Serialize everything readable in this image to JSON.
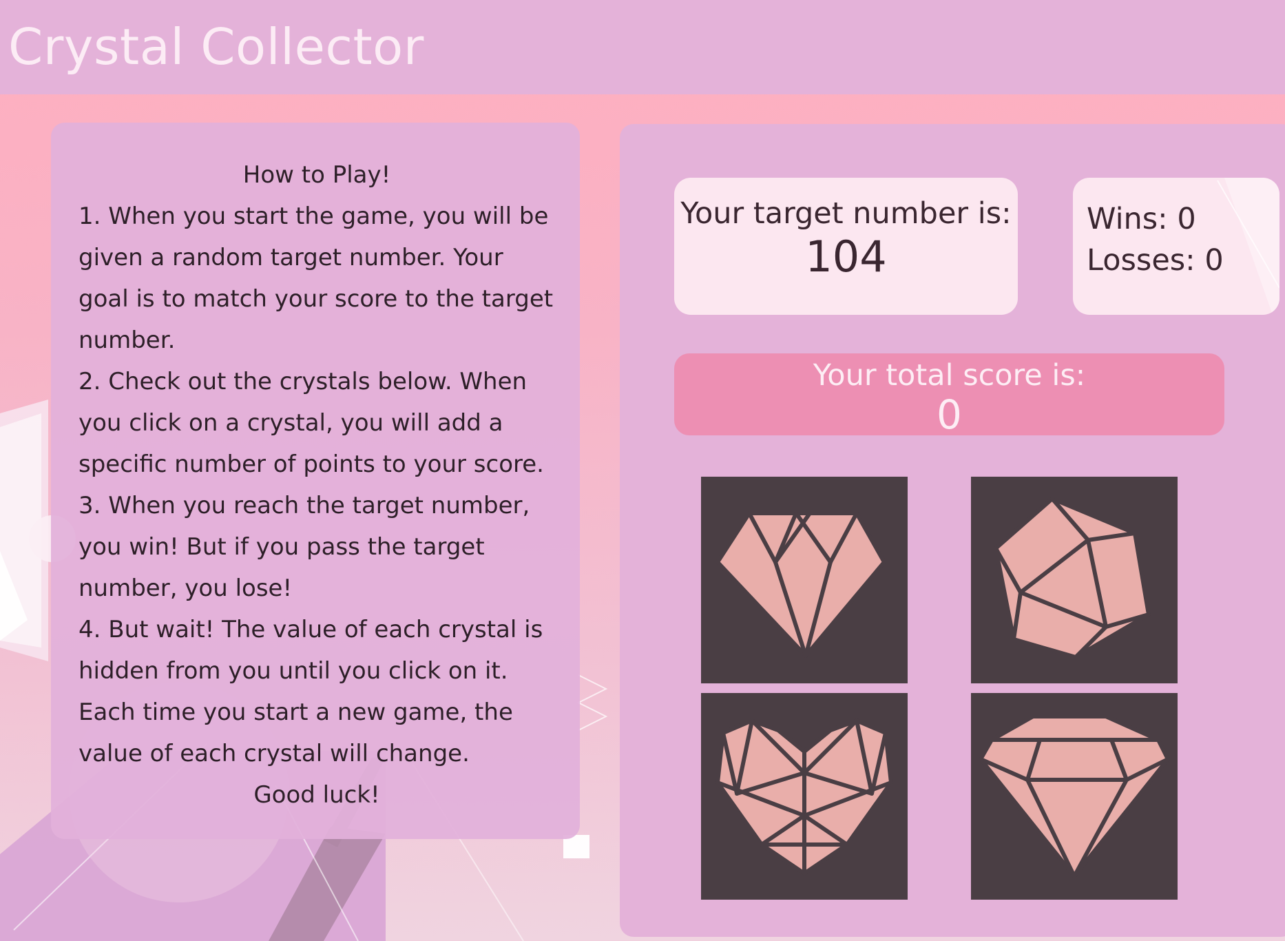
{
  "header": {
    "title": "Crystal Collector"
  },
  "instructions": {
    "heading": "How to Play!",
    "steps": [
      "1. When you start the game, you will be given a random target number. Your goal is to match your score to the target number.",
      "2. Check out the crystals below. When you click on a crystal, you will add a specific number of points to your score.",
      "3. When you reach the target number, you win! But if you pass the target number, you lose!",
      "4. But wait! The value of each crystal is hidden from you until you click on it. Each time you start a new game, the value of each crystal will change."
    ],
    "closing": "Good luck!"
  },
  "game": {
    "target": {
      "label": "Your target number is:",
      "value": "104"
    },
    "record": {
      "wins": "Wins: 0",
      "losses": "Losses: 0"
    },
    "score": {
      "label": "Your total score is:",
      "value": "0"
    },
    "crystals": [
      {
        "shape": "faceted-gem-icon"
      },
      {
        "shape": "polyhedron-gem-icon"
      },
      {
        "shape": "heart-gem-icon"
      },
      {
        "shape": "diamond-gem-icon"
      }
    ]
  },
  "colors": {
    "header_bg": "#e4b2d9",
    "panel_bg": "#e4b2d9",
    "card_bg": "#fce7f0",
    "score_bg": "#ed8fb3",
    "crystal_tile_bg": "#4a3e44",
    "crystal_fill": "#e9aeaa",
    "page_gradient_top": "#ffaebf"
  }
}
